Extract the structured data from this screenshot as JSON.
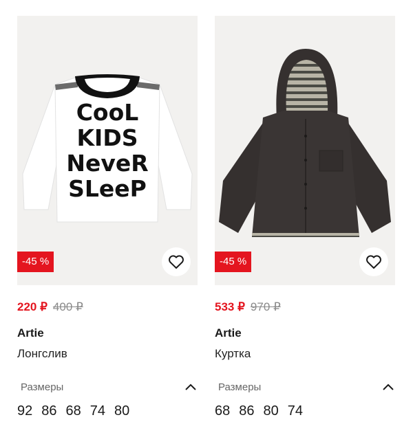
{
  "products": [
    {
      "discount": "-45 %",
      "price_new": "220 ₽",
      "price_old": "400 ₽",
      "brand": "Artie",
      "name": "Лонгслив",
      "sizes_label": "Размеры",
      "sizes": [
        "92",
        "86",
        "68",
        "74",
        "80"
      ],
      "print_text": [
        "CooL",
        "KIDS",
        "NeveR",
        "SLeeP"
      ]
    },
    {
      "discount": "-45 %",
      "price_new": "533 ₽",
      "price_old": "970 ₽",
      "brand": "Artie",
      "name": "Куртка",
      "sizes_label": "Размеры",
      "sizes": [
        "68",
        "86",
        "80",
        "74"
      ]
    }
  ],
  "icons": {
    "favorite": "heart-outline-icon",
    "collapse": "chevron-up-icon"
  },
  "colors": {
    "sale": "#e4151f",
    "old_price": "#8a8a8a",
    "photo_bg": "#f2f1ef"
  }
}
